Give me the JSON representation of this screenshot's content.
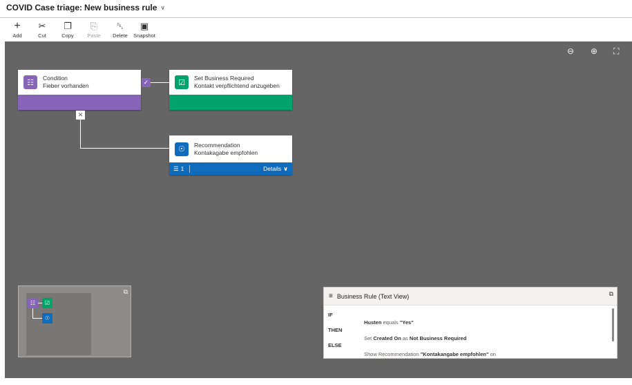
{
  "title": {
    "entity": "COVID Case triage:",
    "rule_name": "New business rule",
    "chevron": "∨"
  },
  "toolbar": [
    {
      "name": "add-button",
      "icon": "plus-icon",
      "glyph": "+",
      "label": "Add",
      "enabled": true
    },
    {
      "name": "cut-button",
      "icon": "scissors-icon",
      "glyph": "✂",
      "label": "Cut",
      "enabled": true
    },
    {
      "name": "copy-button",
      "icon": "copy-icon",
      "glyph": "❐",
      "label": "Copy",
      "enabled": true
    },
    {
      "name": "paste-button",
      "icon": "clipboard-icon",
      "glyph": "⎘",
      "label": "Paste",
      "enabled": false
    },
    {
      "name": "delete-button",
      "icon": "trash-icon",
      "glyph": "␡",
      "label": "Delete",
      "enabled": true
    },
    {
      "name": "snapshot-button",
      "icon": "camera-icon",
      "glyph": "▣",
      "label": "Snapshot",
      "enabled": true
    }
  ],
  "zoom": {
    "zoom_out": "⊖",
    "zoom_in": "⊕",
    "fit": "⛶"
  },
  "condition": {
    "type": "Condition",
    "desc": "Fieber vorhanden",
    "icon": "condition-icon",
    "glyph": "☷",
    "color": "#8764b8"
  },
  "action": {
    "type": "Set Business Required",
    "desc": "Kontakt verpflichtend anzugeben",
    "icon": "check-square-icon",
    "glyph": "☑",
    "color": "#00a36c"
  },
  "recommendation": {
    "type": "Recommendation",
    "desc": "Kontakagabe empfohlen",
    "icon": "lightbulb-icon",
    "glyph": "☉",
    "color": "#0f6cbd",
    "count": "1",
    "details": "Details",
    "details_chevron": "∨",
    "list_glyph": "☰"
  },
  "marks": {
    "yes": "✓",
    "no": "✕"
  },
  "minimap": {
    "expand": "⧉"
  },
  "textview": {
    "title": "Business Rule (Text View)",
    "icon_glyph": "≡",
    "expand": "⧉",
    "if_label": "IF",
    "then_label": "THEN",
    "else_label": "ELSE",
    "if_field": "Husten",
    "if_op": "equals",
    "if_value": "\"Yes\"",
    "then_prefix": "Set",
    "then_field": "Created On",
    "then_as": "as",
    "then_value": "Not Business Required",
    "else_prefix": "Show Recommendation",
    "else_value": "\"Kontakangabe empfohlen\"",
    "else_suffix": "on"
  }
}
